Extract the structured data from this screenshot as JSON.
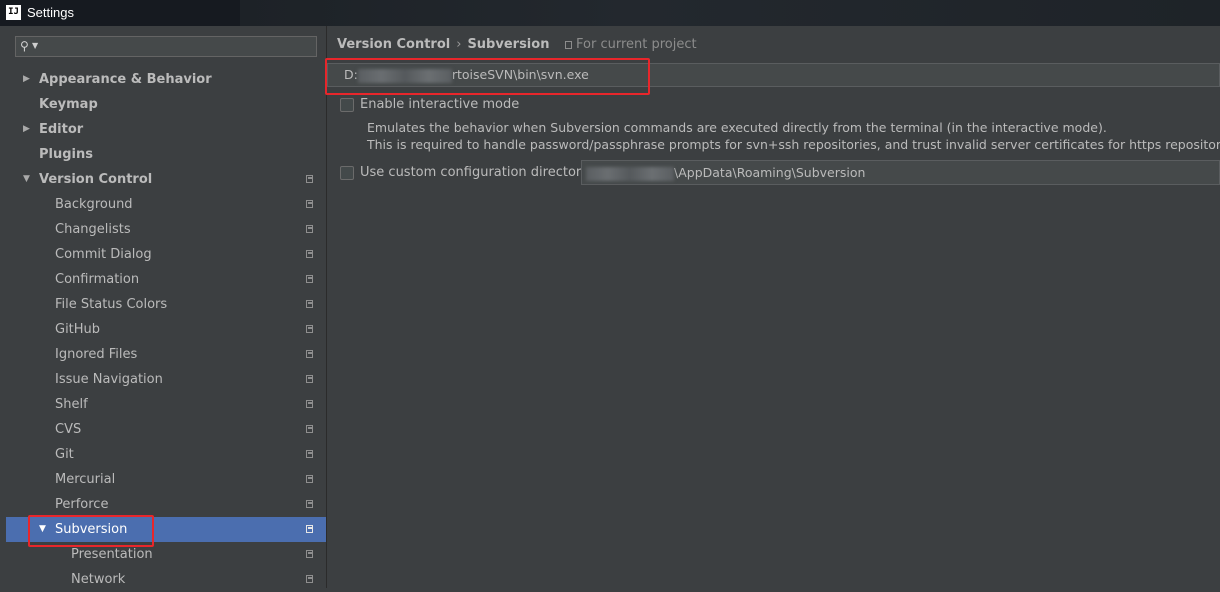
{
  "window": {
    "title": "Settings",
    "app_icon": "IJ"
  },
  "sidebar": {
    "search": {
      "value": "",
      "placeholder": ""
    },
    "items": [
      {
        "label": "Appearance & Behavior",
        "level": 0,
        "bold": true,
        "arrow": "▶",
        "config": false
      },
      {
        "label": "Keymap",
        "level": 0,
        "bold": true,
        "arrow": "",
        "config": false
      },
      {
        "label": "Editor",
        "level": 0,
        "bold": true,
        "arrow": "▶",
        "config": false
      },
      {
        "label": "Plugins",
        "level": 0,
        "bold": true,
        "arrow": "",
        "config": false
      },
      {
        "label": "Version Control",
        "level": 0,
        "bold": true,
        "arrow": "▼",
        "config": true
      },
      {
        "label": "Background",
        "level": 1,
        "bold": false,
        "arrow": "",
        "config": true
      },
      {
        "label": "Changelists",
        "level": 1,
        "bold": false,
        "arrow": "",
        "config": true
      },
      {
        "label": "Commit Dialog",
        "level": 1,
        "bold": false,
        "arrow": "",
        "config": true
      },
      {
        "label": "Confirmation",
        "level": 1,
        "bold": false,
        "arrow": "",
        "config": true
      },
      {
        "label": "File Status Colors",
        "level": 1,
        "bold": false,
        "arrow": "",
        "config": true
      },
      {
        "label": "GitHub",
        "level": 1,
        "bold": false,
        "arrow": "",
        "config": true
      },
      {
        "label": "Ignored Files",
        "level": 1,
        "bold": false,
        "arrow": "",
        "config": true
      },
      {
        "label": "Issue Navigation",
        "level": 1,
        "bold": false,
        "arrow": "",
        "config": true
      },
      {
        "label": "Shelf",
        "level": 1,
        "bold": false,
        "arrow": "",
        "config": true
      },
      {
        "label": "CVS",
        "level": 1,
        "bold": false,
        "arrow": "",
        "config": true
      },
      {
        "label": "Git",
        "level": 1,
        "bold": false,
        "arrow": "",
        "config": true
      },
      {
        "label": "Mercurial",
        "level": 1,
        "bold": false,
        "arrow": "",
        "config": true
      },
      {
        "label": "Perforce",
        "level": 1,
        "bold": false,
        "arrow": "",
        "config": true
      },
      {
        "label": "Subversion",
        "level": 1,
        "bold": false,
        "arrow": "▼",
        "config": true,
        "selected": true
      },
      {
        "label": "Presentation",
        "level": 2,
        "bold": false,
        "arrow": "",
        "config": true
      },
      {
        "label": "Network",
        "level": 2,
        "bold": false,
        "arrow": "",
        "config": true
      }
    ]
  },
  "main": {
    "breadcrumb": {
      "parent": "Version Control",
      "separator": "›",
      "current": "Subversion"
    },
    "scope_label": "For current project",
    "svn_path": {
      "prefix": "D:",
      "suffix": "rtoiseSVN\\bin\\svn.exe"
    },
    "interactive_mode": {
      "label": "Enable interactive mode",
      "checked": false,
      "desc_line1": "Emulates the behavior when Subversion commands are executed directly from the terminal (in the interactive mode).",
      "desc_line2": "This is required to handle password/passphrase prompts for svn+ssh repositories, and trust invalid server certificates for https repositories."
    },
    "custom_config": {
      "label": "Use custom configuration directory:",
      "checked": false,
      "path_suffix": "\\AppData\\Roaming\\Subversion"
    }
  },
  "colors": {
    "background": "#3c3f41",
    "selection": "#4b6eaf",
    "highlight": "#e8262b",
    "text": "#bbbbbb"
  }
}
